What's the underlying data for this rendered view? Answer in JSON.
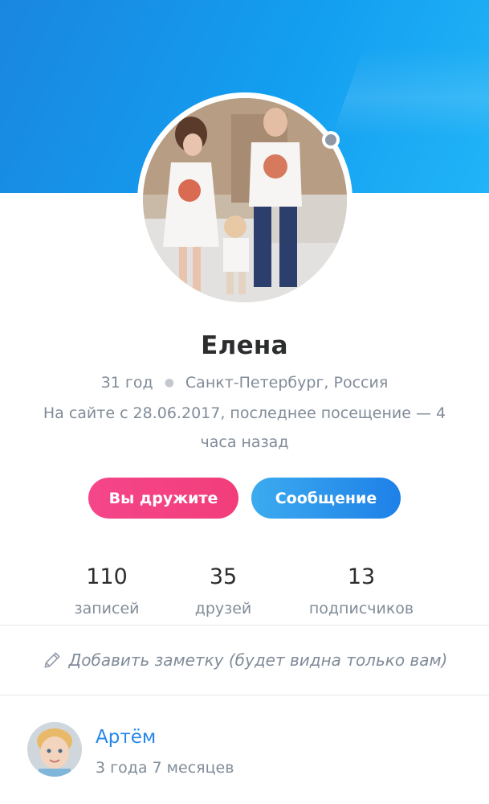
{
  "profile": {
    "name": "Елена",
    "age": "31 год",
    "location": "Санкт-Петербург, Россия",
    "since": "На сайте с 28.06.2017, последнее посещение — 4 часа назад",
    "online_status_icon": "offline-dot-icon"
  },
  "buttons": {
    "friends_label": "Вы дружите",
    "message_label": "Сообщение"
  },
  "stats": [
    {
      "value": "110",
      "label": "записей"
    },
    {
      "value": "35",
      "label": "друзей"
    },
    {
      "value": "13",
      "label": "подписчиков"
    }
  ],
  "note": {
    "icon": "pencil-icon",
    "text": "Добавить заметку (будет видна только вам)"
  },
  "child": {
    "name": "Артём",
    "age": "3 года 7 месяцев"
  },
  "colors": {
    "header_blue": "#1a86df",
    "friends_pink": "#f23d7a",
    "message_blue": "#1e80e8",
    "link_blue": "#2688eb",
    "secondary_text": "#818c99"
  }
}
